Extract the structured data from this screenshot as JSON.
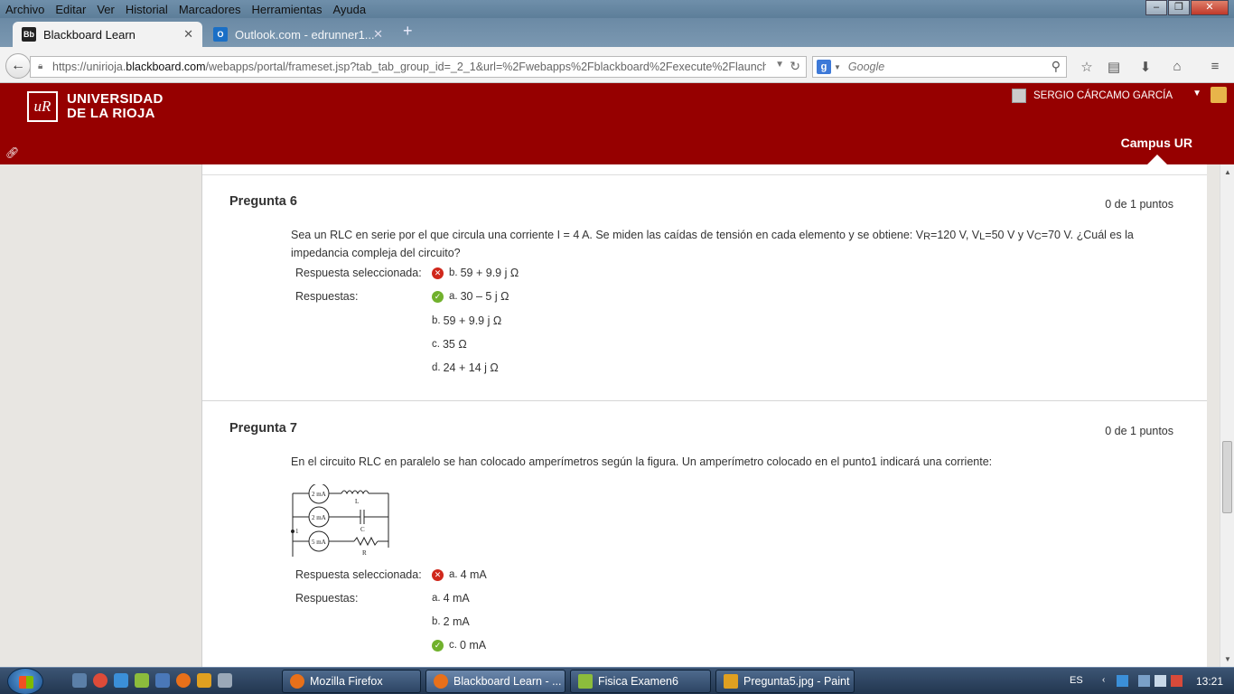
{
  "menubar": {
    "items": [
      "Archivo",
      "Editar",
      "Ver",
      "Historial",
      "Marcadores",
      "Herramientas",
      "Ayuda"
    ]
  },
  "tabs": [
    {
      "label": "Blackboard Learn",
      "favicon": "Bb"
    },
    {
      "label": "Outlook.com - edrunner1...",
      "favicon": "O"
    }
  ],
  "navbar": {
    "url_prefix": "https://unirioja.",
    "url_domain": "blackboard.com",
    "url_suffix": "/webapps/portal/frameset.jsp?tab_tab_group_id=_2_1&url=%2Fwebapps%2Fblackboard%2Fexecute%2Flauncher%3Fty",
    "search_placeholder": "Google"
  },
  "header": {
    "logo_line1": "UNIVERSIDAD",
    "logo_line2": "DE LA RIOJA",
    "user_name": "SERGIO CÁRCAMO GARCÍA",
    "campus_tab": "Campus UR"
  },
  "questions": [
    {
      "title": "Pregunta 6",
      "points": "0 de 1 puntos",
      "text_pre": "Sea un RLC en serie por el que circula una corriente I = 4 A. Se miden las caídas de tensión en cada elemento y se obtiene: V",
      "sub_r": "R",
      "text_mid1": "=120 V, V",
      "sub_l": "L",
      "text_mid2": "=50 V y V",
      "sub_c": "C",
      "text_post": "=70 V. ¿Cuál es la impedancia compleja del circuito?",
      "selected_label": "Respuesta seleccionada:",
      "answers_label": "Respuestas:",
      "selected": {
        "prefix": "b.",
        "text": "59 + 9.9 j Ω",
        "status": "wrong"
      },
      "answers": [
        {
          "prefix": "a.",
          "text": "30 – 5 j Ω",
          "status": "correct"
        },
        {
          "prefix": "b.",
          "text": "59 + 9.9 j Ω",
          "status": "none"
        },
        {
          "prefix": "c.",
          "text": "35 Ω",
          "status": "none"
        },
        {
          "prefix": "d.",
          "text": "24 + 14 j Ω",
          "status": "none"
        }
      ]
    },
    {
      "title": "Pregunta 7",
      "points": "0 de 1 puntos",
      "text": "En el circuito RLC en paralelo se han colocado amperímetros según la figura. Un amperímetro colocado en el punto1 indicará una corriente:",
      "circuit_labels": {
        "m1": "2 mA",
        "m2": "2 mA",
        "m3": "5 mA",
        "l": "L",
        "c": "C",
        "r": "R",
        "p": "1"
      },
      "selected_label": "Respuesta seleccionada:",
      "answers_label": "Respuestas:",
      "selected": {
        "prefix": "a.",
        "text": "4 mA",
        "status": "wrong"
      },
      "answers": [
        {
          "prefix": "a.",
          "text": "4 mA",
          "status": "none"
        },
        {
          "prefix": "b.",
          "text": "2 mA",
          "status": "none"
        },
        {
          "prefix": "c.",
          "text": "0 mA",
          "status": "correct"
        }
      ]
    }
  ],
  "taskbar": {
    "buttons": [
      "Mozilla Firefox",
      "Blackboard Learn - ...",
      "Fisica Examen6",
      "Pregunta5.jpg - Paint"
    ],
    "lang": "ES",
    "time": "13:21"
  },
  "colors": {
    "brand_red": "#960000",
    "wrong": "#d0281c",
    "correct": "#71b12d"
  }
}
